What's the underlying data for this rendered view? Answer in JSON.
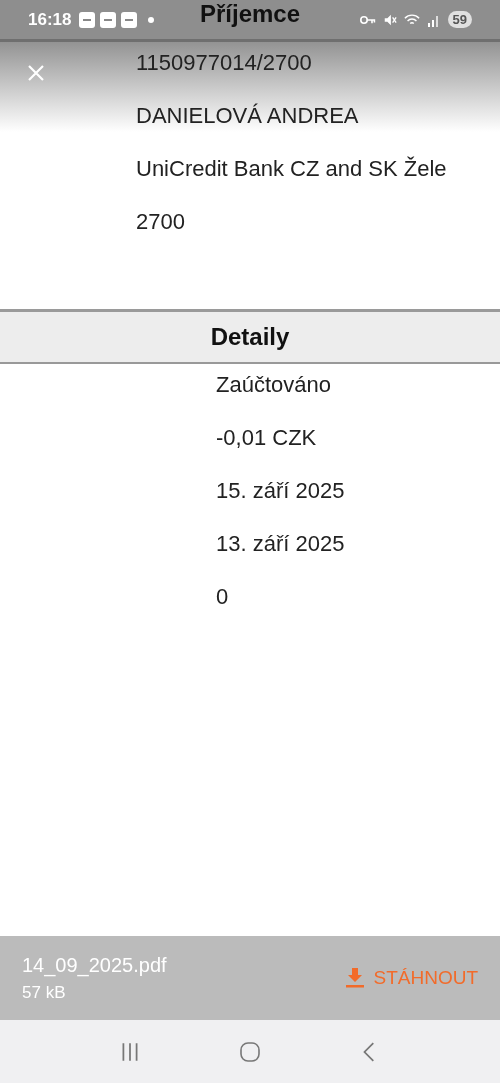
{
  "status_bar": {
    "time": "16:18",
    "battery": "59"
  },
  "title": "Příjemce",
  "recipient": {
    "lines": [
      "1150977014/2700",
      "DANIELOVÁ ANDREA",
      "UniCredit Bank CZ and SK Žele",
      "2700"
    ]
  },
  "details": {
    "heading": "Detaily",
    "lines": [
      "Zaúčtováno",
      "-0,01 CZK",
      "15. září 2025",
      "13. září 2025",
      "0"
    ]
  },
  "file_bar": {
    "name": "14_09_2025.pdf",
    "size": "57 kB",
    "download_label": "STÁHNOUT"
  }
}
